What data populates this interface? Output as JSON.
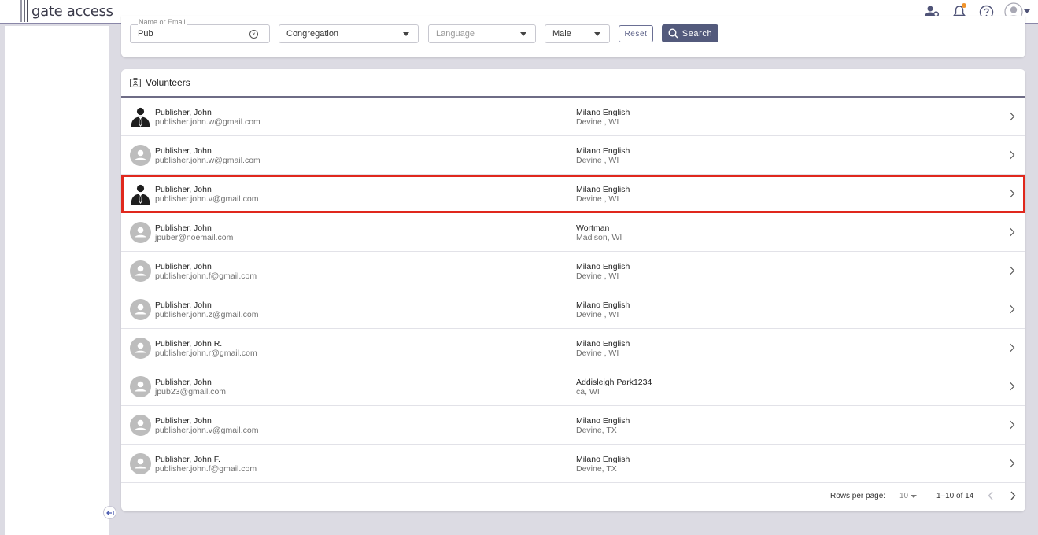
{
  "app": {
    "logo_text": "gate access"
  },
  "topbar": {
    "icons": [
      "person-search-icon",
      "bell-icon",
      "help-icon",
      "account-avatar-icon"
    ],
    "notification_dot_color": "#f0932b"
  },
  "filters": {
    "name_email": {
      "label": "Name or Email",
      "value": "Pub"
    },
    "congregation": {
      "value": "Congregation"
    },
    "language": {
      "placeholder": "Language"
    },
    "gender": {
      "value": "Male"
    },
    "reset_label": "Reset",
    "search_label": "Search"
  },
  "volunteers": {
    "title": "Volunteers",
    "rows": [
      {
        "name": "Publisher, John",
        "email": "publisher.john.w@gmail.com",
        "congregation": "Milano English",
        "location": "Devine , WI",
        "avatar": "suit-person-icon"
      },
      {
        "name": "Publisher, John",
        "email": "publisher.john.w@gmail.com",
        "congregation": "Milano English",
        "location": "Devine , WI",
        "avatar": "generic-person-icon"
      },
      {
        "name": "Publisher, John",
        "email": "publisher.john.v@gmail.com",
        "congregation": "Milano English",
        "location": "Devine , WI",
        "avatar": "suit-person-icon"
      },
      {
        "name": "Publisher, John",
        "email": "jpuber@noemail.com",
        "congregation": "Wortman",
        "location": "Madison, WI",
        "avatar": "generic-person-icon"
      },
      {
        "name": "Publisher, John",
        "email": "publisher.john.f@gmail.com",
        "congregation": "Milano English",
        "location": "Devine , WI",
        "avatar": "generic-person-icon"
      },
      {
        "name": "Publisher, John",
        "email": "publisher.john.z@gmail.com",
        "congregation": "Milano English",
        "location": "Devine , WI",
        "avatar": "generic-person-icon"
      },
      {
        "name": "Publisher, John R.",
        "email": "publisher.john.r@gmail.com",
        "congregation": "Milano English",
        "location": "Devine , WI",
        "avatar": "generic-person-icon"
      },
      {
        "name": "Publisher, John",
        "email": "jpub23@gmail.com",
        "congregation": "Addisleigh Park1234",
        "location": "ca, WI",
        "avatar": "generic-person-icon"
      },
      {
        "name": "Publisher, John",
        "email": "publisher.john.v@gmail.com",
        "congregation": "Milano English",
        "location": "Devine, TX",
        "avatar": "generic-person-icon"
      },
      {
        "name": "Publisher, John F.",
        "email": "publisher.john.f@gmail.com",
        "congregation": "Milano English",
        "location": "Devine, TX",
        "avatar": "generic-person-icon"
      }
    ],
    "selected_row_index": 2,
    "highlight_color": "#e0281d"
  },
  "pagination": {
    "rows_per_page_label": "Rows per page:",
    "rows_per_page_value": "10",
    "range": "1–10 of 14"
  }
}
